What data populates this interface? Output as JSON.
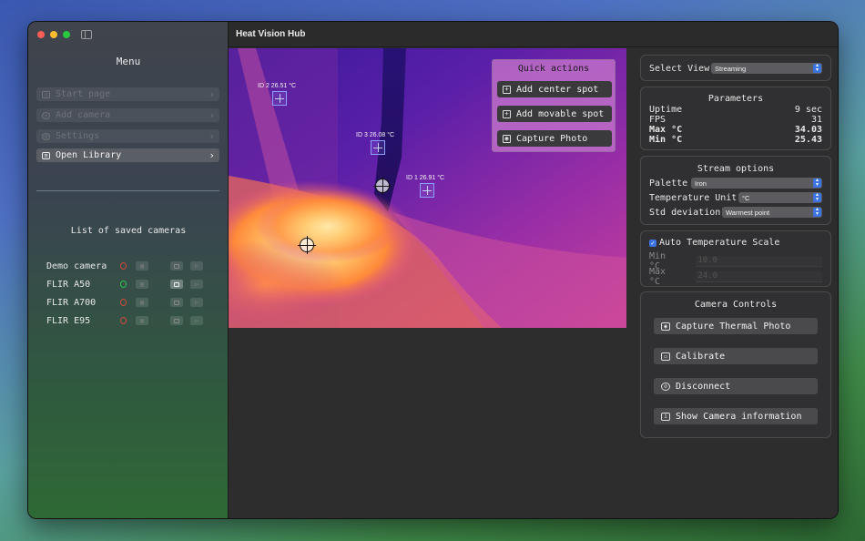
{
  "app": {
    "title": "Heat Vision Hub"
  },
  "sidebar": {
    "menu_title": "Menu",
    "items": [
      {
        "label": "Start page",
        "icon": "home-icon",
        "enabled": false
      },
      {
        "label": "Add camera",
        "icon": "plus-circle-icon",
        "enabled": false
      },
      {
        "label": "Settings",
        "icon": "gear-icon",
        "enabled": false
      },
      {
        "label": "Open Library",
        "icon": "library-icon",
        "enabled": true
      }
    ],
    "saved_title": "List of saved cameras",
    "cameras": [
      {
        "name": "Demo camera",
        "status": "disconnected"
      },
      {
        "name": "FLIR A50",
        "status": "connected"
      },
      {
        "name": "FLIR A700",
        "status": "disconnected"
      },
      {
        "name": "FLIR E95",
        "status": "disconnected"
      }
    ]
  },
  "spots": [
    {
      "label": "ID 2  26.51 °C"
    },
    {
      "label": "ID 3  26.08 °C"
    },
    {
      "label": "ID 1  26.91 °C"
    }
  ],
  "quick_actions": {
    "title": "Quick actions",
    "buttons": [
      "Add center spot",
      "Add movable spot",
      "Capture Photo"
    ]
  },
  "view": {
    "label": "Select View",
    "value": "Streaming"
  },
  "parameters": {
    "title": "Parameters",
    "rows": [
      {
        "label": "Uptime",
        "value": "9 sec"
      },
      {
        "label": "FPS",
        "value": "31"
      },
      {
        "label": "Max °C",
        "value": "34.03"
      },
      {
        "label": "Min °C",
        "value": "25.43"
      }
    ]
  },
  "stream_options": {
    "title": "Stream options",
    "palette_label": "Palette",
    "palette_value": "Iron",
    "unit_label": "Temperature Unit",
    "unit_value": "°C",
    "std_label": "Std deviation",
    "std_value": "Warmest point"
  },
  "auto_scale": {
    "label": "Auto Temperature Scale",
    "checked": true,
    "min_label": "Min °C",
    "min_placeholder": "10.0",
    "max_label": "Max °C",
    "max_placeholder": "24.0"
  },
  "camera_controls": {
    "title": "Camera Controls",
    "buttons": [
      "Capture Thermal Photo",
      "Calibrate",
      "Disconnect",
      "Show Camera information"
    ]
  },
  "colors": {
    "accent": "#3b73e0",
    "status_on": "#30c04a",
    "status_off": "#d04a3a"
  }
}
